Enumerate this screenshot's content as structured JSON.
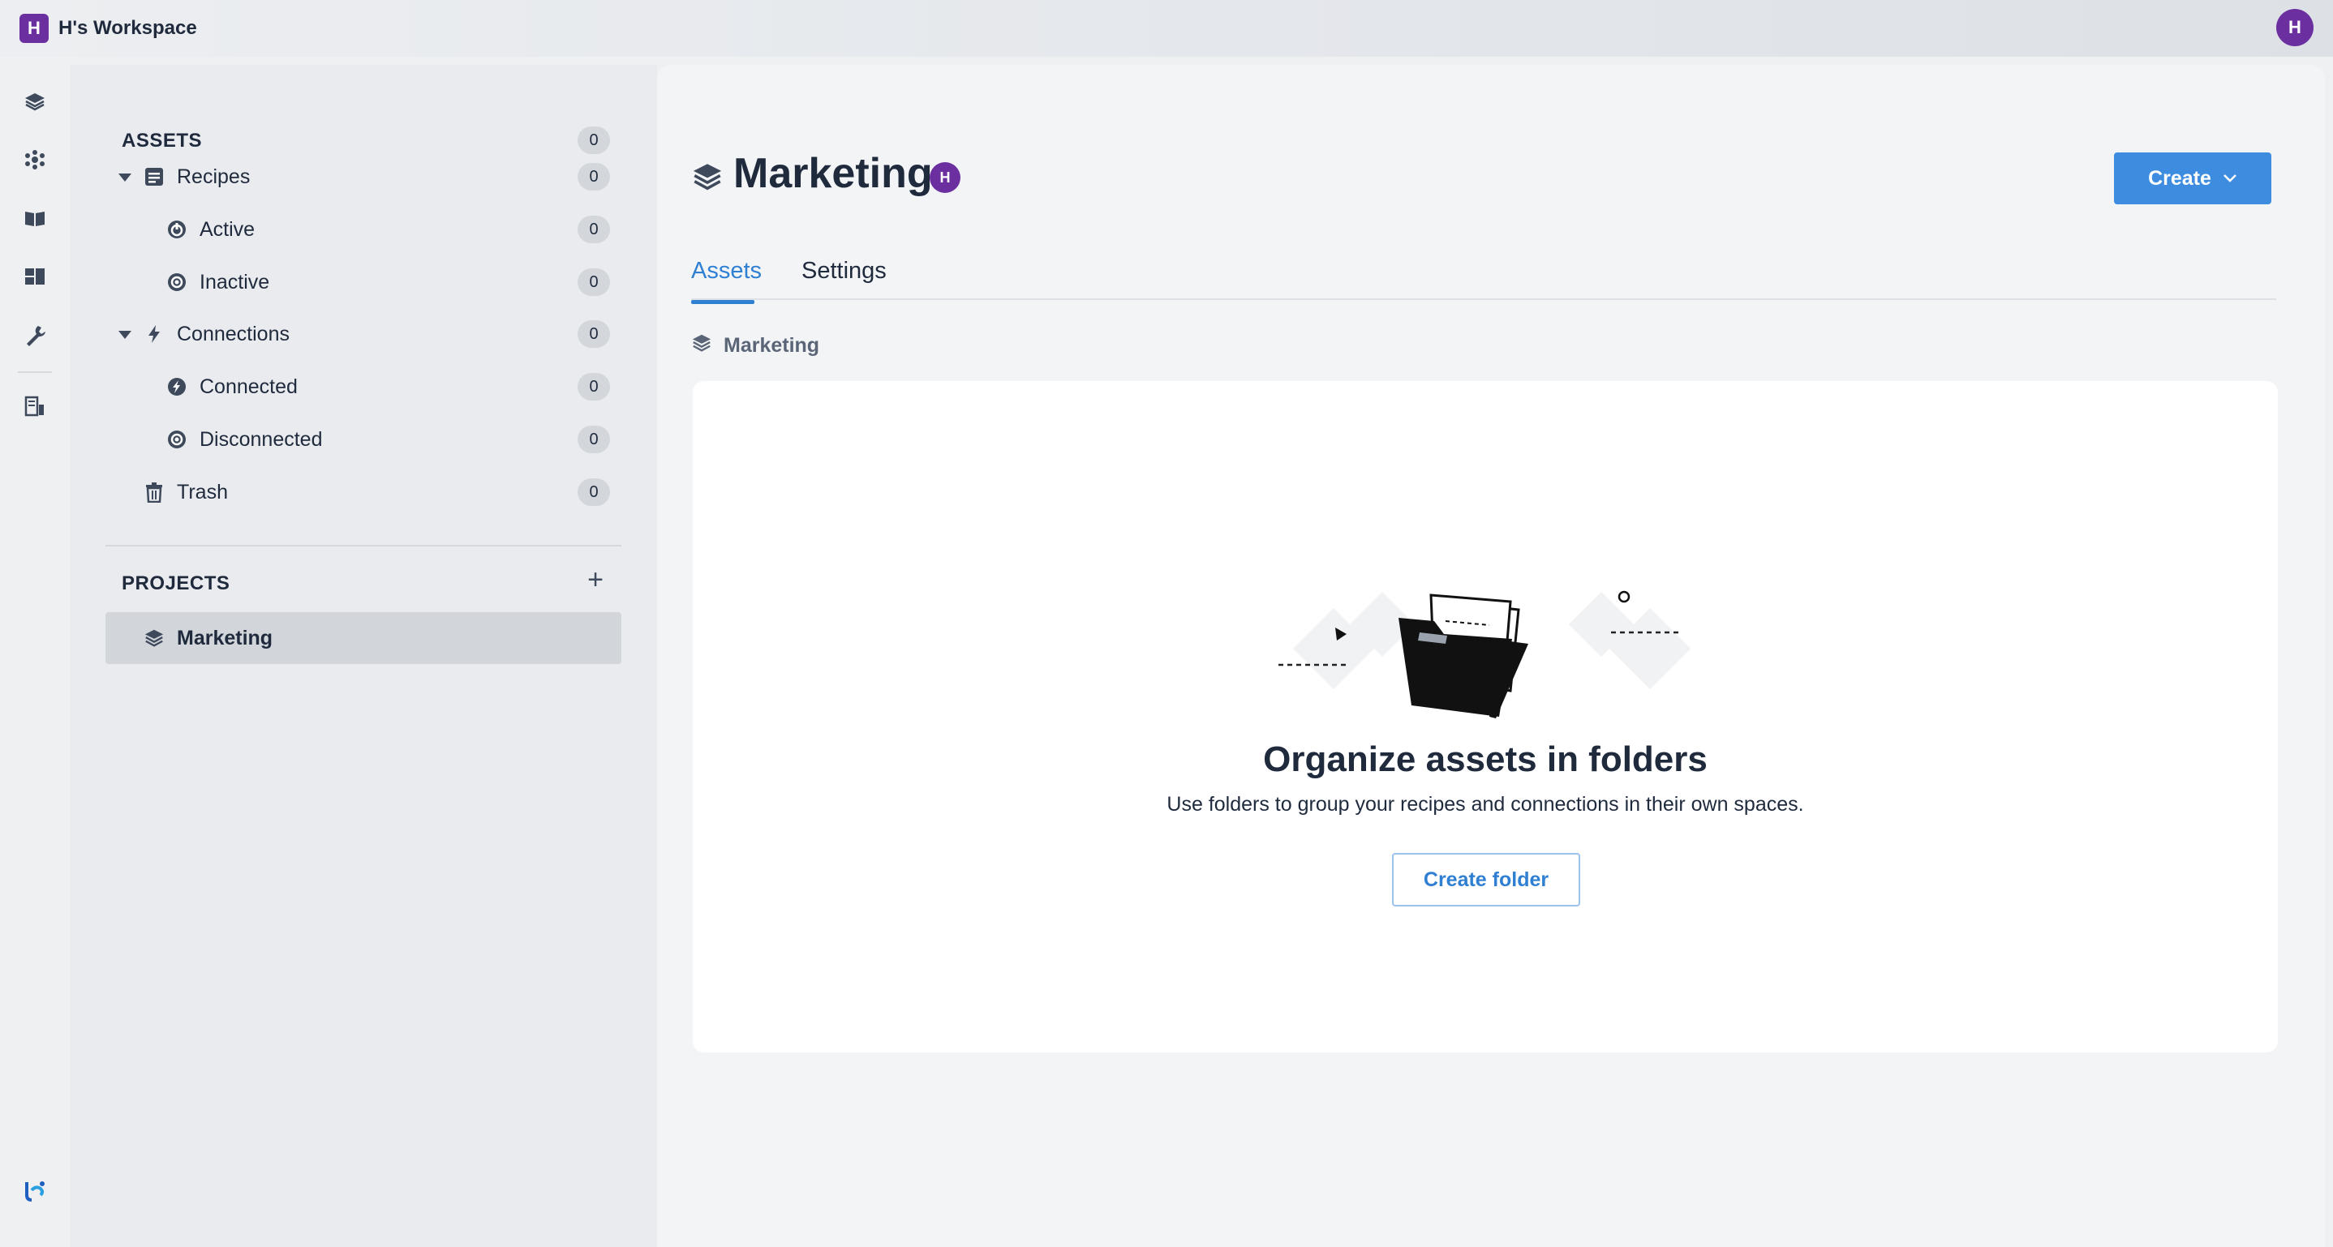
{
  "workspace": {
    "badge": "H",
    "name": "H's Workspace",
    "user_initial": "H"
  },
  "rail": {
    "icons": [
      "projects-icon",
      "automation-icon",
      "docs-icon",
      "dashboard-icon",
      "tools-icon",
      "data-icon"
    ],
    "logo": "workato-logo-icon"
  },
  "assets": {
    "heading": "ASSETS",
    "total": "0",
    "recipes": {
      "label": "Recipes",
      "count": "0",
      "active": {
        "label": "Active",
        "count": "0"
      },
      "inactive": {
        "label": "Inactive",
        "count": "0"
      }
    },
    "connections": {
      "label": "Connections",
      "count": "0",
      "connected": {
        "label": "Connected",
        "count": "0"
      },
      "disconnected": {
        "label": "Disconnected",
        "count": "0"
      }
    },
    "trash": {
      "label": "Trash",
      "count": "0"
    }
  },
  "projects": {
    "heading": "PROJECTS",
    "items": [
      {
        "label": "Marketing"
      }
    ]
  },
  "main": {
    "title": "Marketing",
    "owner_initial": "H",
    "create_label": "Create",
    "tabs": [
      {
        "label": "Assets",
        "active": true
      },
      {
        "label": "Settings",
        "active": false
      }
    ],
    "breadcrumb": "Marketing",
    "empty_state": {
      "title": "Organize assets in folders",
      "subtitle": "Use folders to group your recipes and connections in their own spaces.",
      "button": "Create folder"
    }
  },
  "colors": {
    "accent": "#3d8ce0",
    "brand_purple": "#6b2fa0",
    "text": "#1f2a3d"
  }
}
